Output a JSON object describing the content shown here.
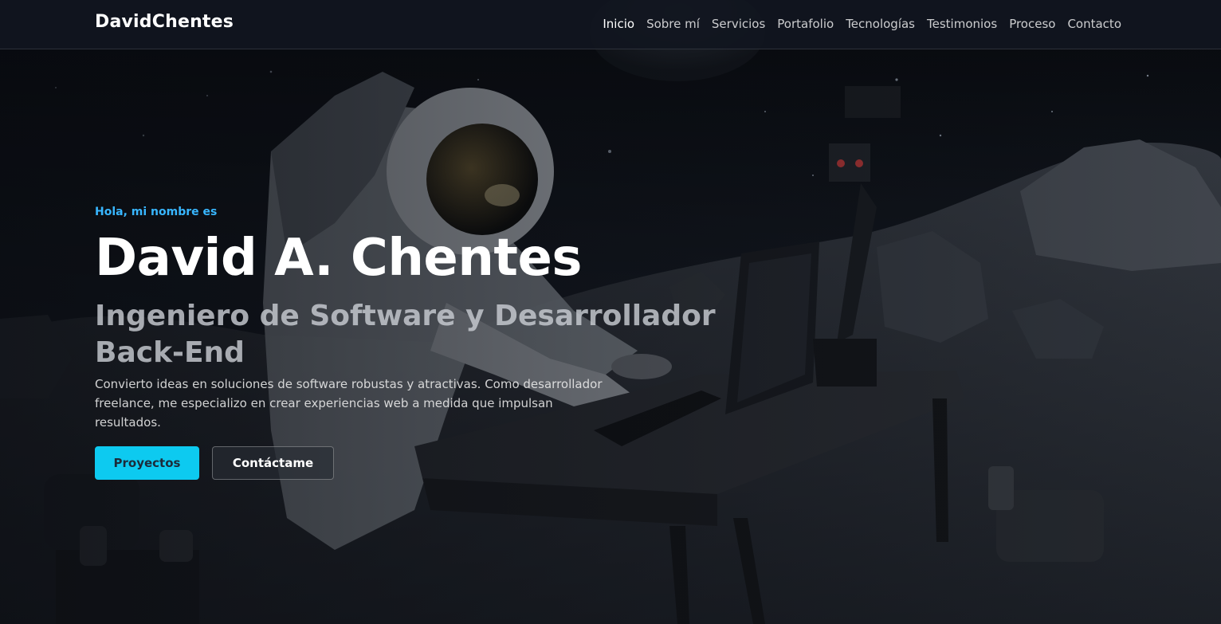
{
  "navbar": {
    "brand": "DavidChentes",
    "links": [
      "Inicio",
      "Sobre mí",
      "Servicios",
      "Portafolio",
      "Tecnologías",
      "Testimonios",
      "Proceso",
      "Contacto"
    ]
  },
  "hero": {
    "eyebrow": "Hola, mi nombre es",
    "name": "David A. Chentes",
    "role": "Ingeniero de Software y Desarrollador Back-End",
    "description": "Convierto ideas en soluciones de software robustas y atractivas. Como desarrollador freelance, me especializo en crear experiencias web a medida que impulsan resultados.",
    "primary_button": "Proyectos",
    "secondary_button": "Contáctame",
    "background_image": "astronaut-working-on-computer-on-moon"
  },
  "colors": {
    "accent": "#0dcaf0",
    "eyebrow": "#38b6ff",
    "navbar_bg": "#11161f"
  }
}
